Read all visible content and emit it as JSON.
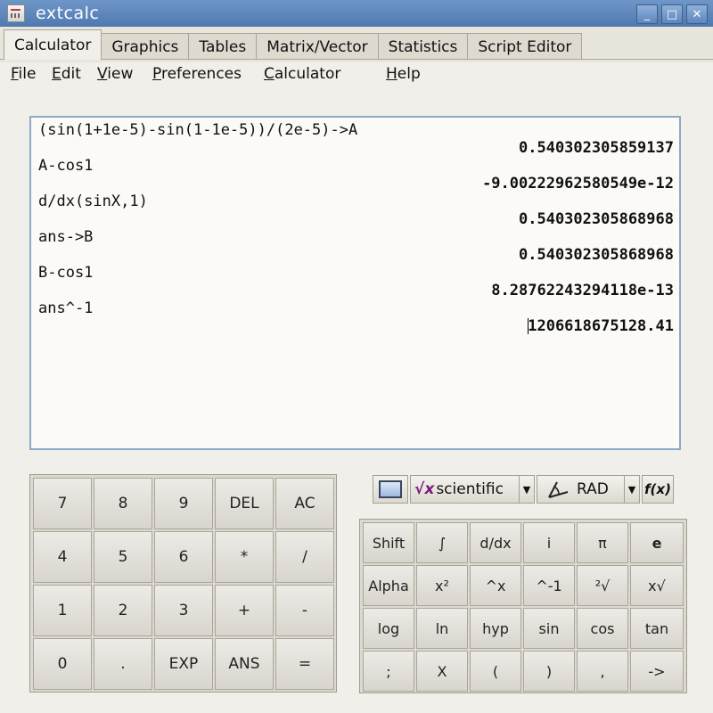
{
  "window": {
    "title": "extcalc",
    "controls": [
      "_",
      "□",
      "✕"
    ]
  },
  "tabs": [
    "Calculator",
    "Graphics",
    "Tables",
    "Matrix/Vector",
    "Statistics",
    "Script Editor"
  ],
  "menu": [
    "File",
    "Edit",
    "View",
    "Preferences",
    "Calculator",
    "Help"
  ],
  "display": {
    "entries": [
      {
        "input": "(sin(1+1e-5)-sin(1-1e-5))/(2e-5)->A",
        "result": "0.540302305859137"
      },
      {
        "input": "A-cos1",
        "result": "-9.00222962580549e-12"
      },
      {
        "input": "d/dx(sinX,1)",
        "result": "0.540302305868968"
      },
      {
        "input": "ans->B",
        "result": "0.540302305868968"
      },
      {
        "input": "B-cos1",
        "result": "8.28762243294118e-13"
      },
      {
        "input": "ans^-1",
        "result": "1206618675128.41"
      }
    ]
  },
  "keypad_left": [
    [
      "7",
      "8",
      "9",
      "DEL",
      "AC"
    ],
    [
      "4",
      "5",
      "6",
      "*",
      "/"
    ],
    [
      "1",
      "2",
      "3",
      "+",
      "-"
    ],
    [
      "0",
      ".",
      "EXP",
      "ANS",
      "="
    ]
  ],
  "mode": {
    "type_label": "scientific",
    "type_glyph": "√x",
    "angle_label": "RAD",
    "function_label": "f(x)"
  },
  "keypad_right": [
    [
      "Shift",
      "∫",
      "d/dx",
      "i",
      "π",
      "e"
    ],
    [
      "Alpha",
      "x²",
      "^x",
      "^-1",
      "²√",
      "x√"
    ],
    [
      "log",
      "ln",
      "hyp",
      "sin",
      "cos",
      "tan"
    ],
    [
      ";",
      "X",
      "(",
      ")",
      ",",
      "->"
    ]
  ]
}
